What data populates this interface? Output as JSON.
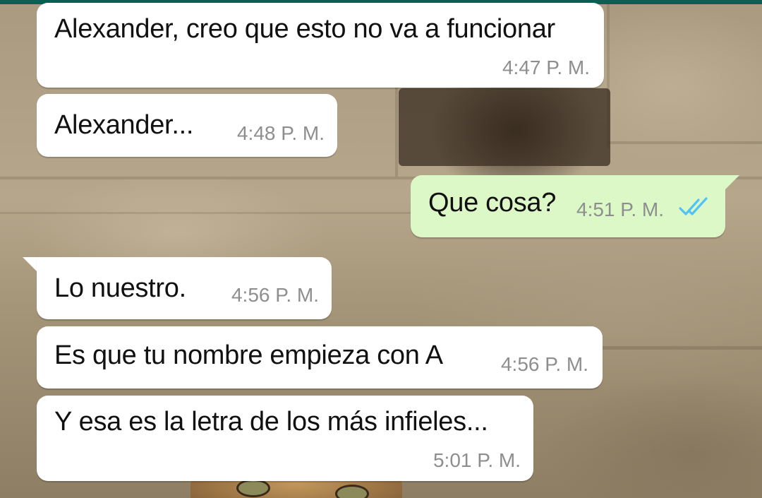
{
  "conversation": {
    "messages": [
      {
        "direction": "incoming",
        "text": "Alexander, creo que esto no va a funcionar",
        "time": "4:47 P. M."
      },
      {
        "direction": "incoming",
        "text": "Alexander...",
        "time": "4:48 P. M."
      },
      {
        "direction": "outgoing",
        "text": "Que cosa?",
        "time": "4:51 P. M.",
        "status": "read",
        "status_icon": "double-check-icon"
      },
      {
        "direction": "incoming",
        "text": "Lo nuestro.",
        "time": "4:56 P. M."
      },
      {
        "direction": "incoming",
        "text": "Es que tu nombre empieza con A",
        "time": "4:56 P. M."
      },
      {
        "direction": "incoming",
        "text": "Y esa es la letra de los más infieles...",
        "time": "5:01 P. M."
      }
    ]
  },
  "colors": {
    "incoming_bubble": "#ffffff",
    "outgoing_bubble": "#dcf8c6",
    "read_ticks": "#4fc3f7",
    "header_bar": "#0b5e52",
    "timestamp": "#8e8e8e"
  }
}
